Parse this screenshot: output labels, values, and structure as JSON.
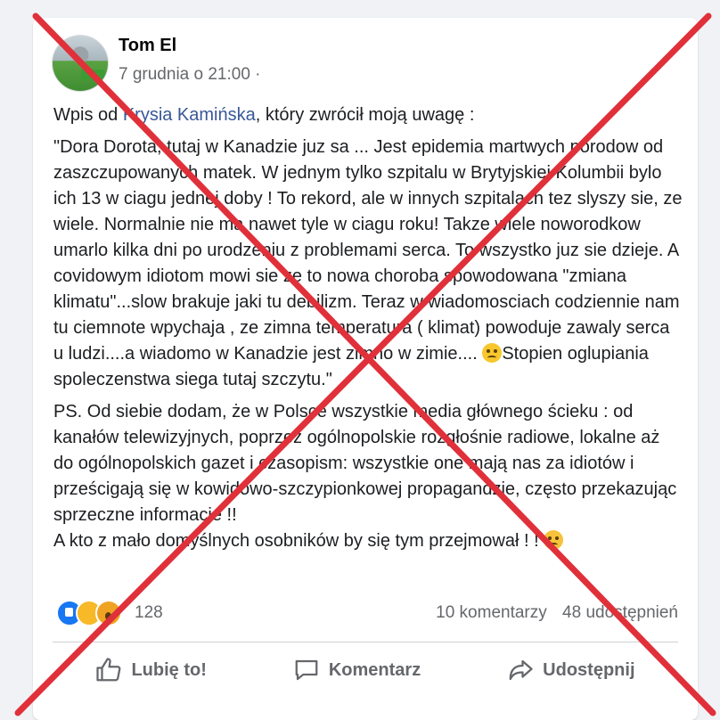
{
  "post": {
    "author": "Tom El",
    "timestamp": "7 grudnia o 21:00 ·",
    "paragraph1": {
      "prefix": "Wpis od ",
      "link": "Krysia Kamińska",
      "suffix": ", który zwrócił moją uwagę :"
    },
    "paragraph2_main": "\"Dora Dorota, tutaj w Kanadzie juz sa ... Jest epidemia martwych porodow od zaszczupowanych matek. W jednym tylko szpitalu w Brytyjskiej Kolumbii bylo ich 13 w ciagu jednej doby ! To rekord, ale w innych szpitalach  tez slyszy sie, ze wiele. Normalnie nie ma nawet tyle w ciagu roku! Takze wiele noworodkow umarlo kilka dni po urodzeniu z problemami serca. To wszystko juz sie dzieje. A covidowym idiotom mowi sie ze to nowa choroba spowodowana  \"zmiana klimatu\"...slow brakuje jaki tu debilizm. Teraz w wiadomosciach codziennie nam tu ciemnote wpychaja , ze zimna temperatura ( klimat) powoduje zawaly serca u ludzi....a wiadomo w Kanadzie jest zimno w zimie.... ",
    "paragraph2_end": "Stopien oglupiania spoleczenstwa siega tutaj szczytu.\"",
    "paragraph3": "PS. Od siebie dodam, że w Polsce wszystkie media głównego ścieku : od kanałów telewizyjnych, poprzez ogólnopolskie rozgłośnie radiowe, lokalne aż do ogólnopolskich gazet i czasopism: wszystkie one mają nas za idiotów i prześcigają się w kowidowo-szczypionkowej propagandzie, często przekazując sprzeczne informacje !!",
    "paragraph4": "A kto z mało domyślnych osobników by się tym przejmował ! !",
    "emoji_eyeroll": "rolling-eyes-emoji",
    "emoji_smirk": "smirking-emoji"
  },
  "reactions": {
    "icons": [
      "like-reaction-icon",
      "sad-reaction-icon",
      "wow-reaction-icon"
    ],
    "count": "128"
  },
  "stats": {
    "comments": "10 komentarzy",
    "shares": "48 udostępnień"
  },
  "actions": {
    "like": "Lubię to!",
    "comment": "Komentarz",
    "share": "Udostępnij"
  },
  "colors": {
    "cross": "#e0303a",
    "link": "#385898",
    "like_blue": "#1877f2"
  }
}
